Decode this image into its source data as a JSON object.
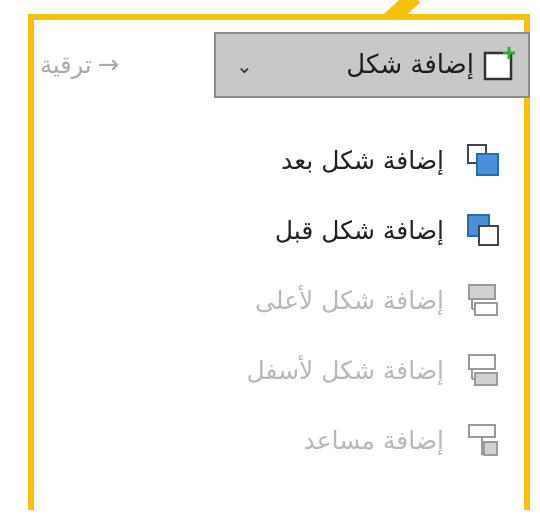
{
  "toolbar": {
    "add_shape_label": "إضافة شكل",
    "promote_label": "ترقية"
  },
  "menu": {
    "items": [
      {
        "label": "إضافة شكل بعد",
        "icon": "add-shape-after-icon",
        "enabled": true
      },
      {
        "label": "إضافة شكل قبل",
        "icon": "add-shape-before-icon",
        "enabled": true
      },
      {
        "label": "إضافة شكل لأعلى",
        "icon": "add-shape-above-icon",
        "enabled": false
      },
      {
        "label": "إضافة شكل لأسفل",
        "icon": "add-shape-below-icon",
        "enabled": false
      },
      {
        "label": "إضافة مساعد",
        "icon": "add-assistant-icon",
        "enabled": false
      }
    ]
  },
  "colors": {
    "highlight_border": "#f4c20d",
    "shape_blue": "#4a90d9",
    "shape_blue_border": "#2c6aa8",
    "disabled_gray": "#b8b8b8",
    "button_bg": "#c8c8c8"
  }
}
